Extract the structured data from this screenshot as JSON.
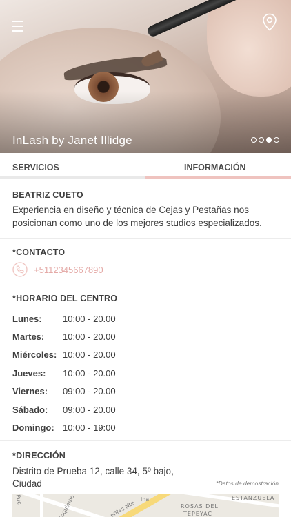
{
  "hero": {
    "title": "InLash by Janet Illidge",
    "slides_total": 4,
    "slide_active": 3
  },
  "header": {
    "menu_icon": "hamburger-menu-icon",
    "location_icon": "map-pin-icon"
  },
  "tabs": [
    {
      "label": "SERVICIOS",
      "active": false
    },
    {
      "label": "INFORMACIÓN",
      "active": true
    }
  ],
  "about": {
    "title": "BEATRIZ CUETO",
    "description": "Experiencia en diseño y técnica de Cejas y Pestañas nos posicionan como uno de los mejores studios especializados."
  },
  "contact": {
    "title": "*CONTACTO",
    "icon": "phone-icon",
    "phone": "+5112345667890"
  },
  "schedule": {
    "title": "*HORARIO DEL CENTRO",
    "rows": [
      {
        "day": "Lunes:",
        "hours": "10:00 - 20.00"
      },
      {
        "day": "Martes:",
        "hours": "10:00 - 20.00"
      },
      {
        "day": "Miércoles:",
        "hours": "10:00 - 20.00"
      },
      {
        "day": "Jueves:",
        "hours": "10:00 - 20.00"
      },
      {
        "day": "Viernes:",
        "hours": "09:00 - 20.00"
      },
      {
        "day": "Sábado:",
        "hours": "09:00 - 20.00"
      },
      {
        "day": "Domingo:",
        "hours": "10:00 - 19:00"
      }
    ]
  },
  "address": {
    "title": "*DIRECCIÓN",
    "text": "Distrito de Prueba 12, calle 34, 5º bajo, Ciudad",
    "demo_note": "*Datos de demostración"
  },
  "map": {
    "labels": [
      "Puc",
      "Coquimbo",
      "entes Nte",
      "ESTANZUELA",
      "ROSAS DEL",
      "TEPEYAC",
      "ina"
    ]
  },
  "colors": {
    "accent": "#efc3bf",
    "phone_text": "#e4a9a6",
    "tab_inactive_bar": "#e9e9e9"
  }
}
